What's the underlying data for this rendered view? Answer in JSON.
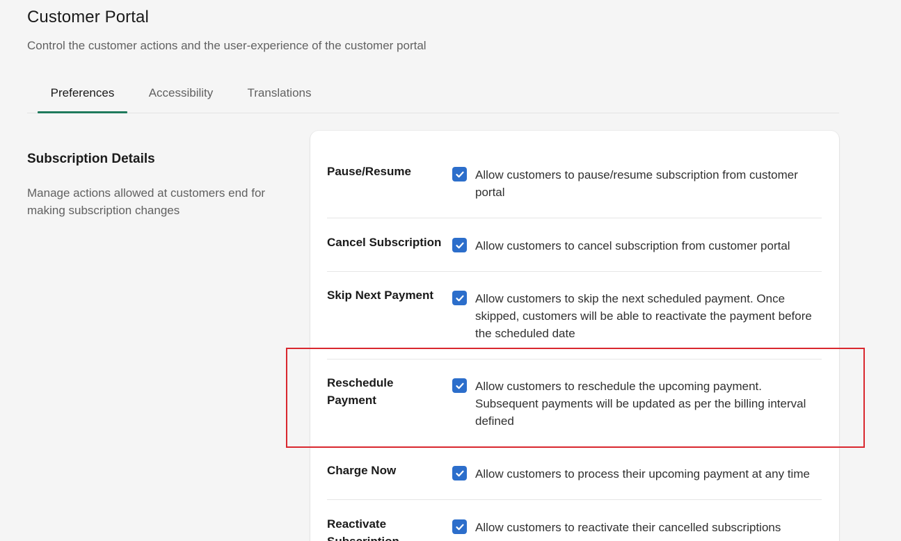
{
  "header": {
    "title": "Customer Portal",
    "subtitle": "Control the customer actions and the user-experience of the customer portal"
  },
  "tabs": [
    {
      "label": "Preferences",
      "active": true
    },
    {
      "label": "Accessibility",
      "active": false
    },
    {
      "label": "Translations",
      "active": false
    }
  ],
  "section": {
    "title": "Subscription Details",
    "description": "Manage actions allowed at customers end for making subscription changes"
  },
  "settings": [
    {
      "label": "Pause/Resume",
      "checked": true,
      "description": "Allow customers to pause/resume subscription from customer portal"
    },
    {
      "label": "Cancel Subscription",
      "checked": true,
      "description": "Allow customers to cancel subscription from customer portal"
    },
    {
      "label": "Skip Next Payment",
      "checked": true,
      "description": "Allow customers to skip the next scheduled payment. Once skipped, customers will be able to reactivate the payment before the scheduled date"
    },
    {
      "label": "Reschedule Payment",
      "checked": true,
      "description": "Allow customers to reschedule the upcoming payment. Subsequent payments will be updated as per the billing interval defined"
    },
    {
      "label": "Charge Now",
      "checked": true,
      "description": "Allow customers to process their upcoming payment at any time"
    },
    {
      "label": "Reactivate Subscription",
      "checked": true,
      "description": "Allow customers to reactivate their cancelled subscriptions"
    }
  ],
  "icons": {
    "checkbox": "checkmark-icon"
  },
  "colors": {
    "accent_tab": "#1f7a5c",
    "checkbox": "#2c6ecb",
    "highlight": "#d9272e"
  }
}
